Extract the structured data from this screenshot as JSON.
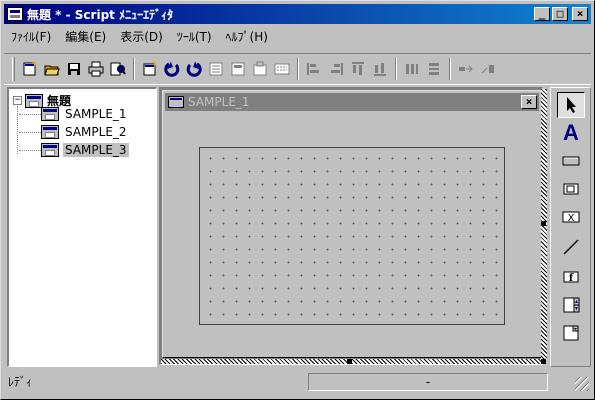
{
  "window": {
    "title": "無題 * - Script ﾒﾆｭｰｴﾃﾞｨﾀ",
    "minimize_glyph": "_",
    "maximize_glyph": "□",
    "close_glyph": "×"
  },
  "menubar": {
    "items": [
      "ﾌｧｲﾙ(F)",
      "編集(E)",
      "表示(D)",
      "ﾂｰﾙ(T)",
      "ﾍﾙﾌﾟ(H)"
    ]
  },
  "toolbar": {
    "icons": [
      "new-menu-icon",
      "open-icon",
      "save-icon",
      "print-icon",
      "preview-icon",
      "new-item-icon",
      "undo-icon",
      "redo-icon",
      "align-left-icon",
      "align-center-icon",
      "align-right-icon",
      "align-top-icon",
      "align-middle-icon",
      "align-bottom-icon",
      "same-width-icon",
      "same-height-icon",
      "space-horiz-icon",
      "space-vert-icon"
    ]
  },
  "tree": {
    "root_label": "無題",
    "expander": "−",
    "children": [
      {
        "label": "SAMPLE_1",
        "selected": false
      },
      {
        "label": "SAMPLE_2",
        "selected": false
      },
      {
        "label": "SAMPLE_3",
        "selected": true
      }
    ]
  },
  "child_window": {
    "title": "SAMPLE_1",
    "close_glyph": "×"
  },
  "palette": {
    "tools": [
      "pointer-icon",
      "text-label-icon",
      "button-icon",
      "checkbox-icon",
      "textbox-icon",
      "line-icon",
      "function-icon",
      "spin-icon",
      "dropdown-icon"
    ],
    "text_tool_glyph": "A",
    "function_tool_glyph": "f",
    "textbox_tool_glyph": "X"
  },
  "status": {
    "left": "ﾚﾃﾞｨ",
    "right": "-"
  },
  "colors": {
    "title_active": "#000080",
    "title_inactive": "#808080",
    "face": "#c0c0c0",
    "icon_orange": "#e0a000",
    "icon_blue": "#000080"
  }
}
